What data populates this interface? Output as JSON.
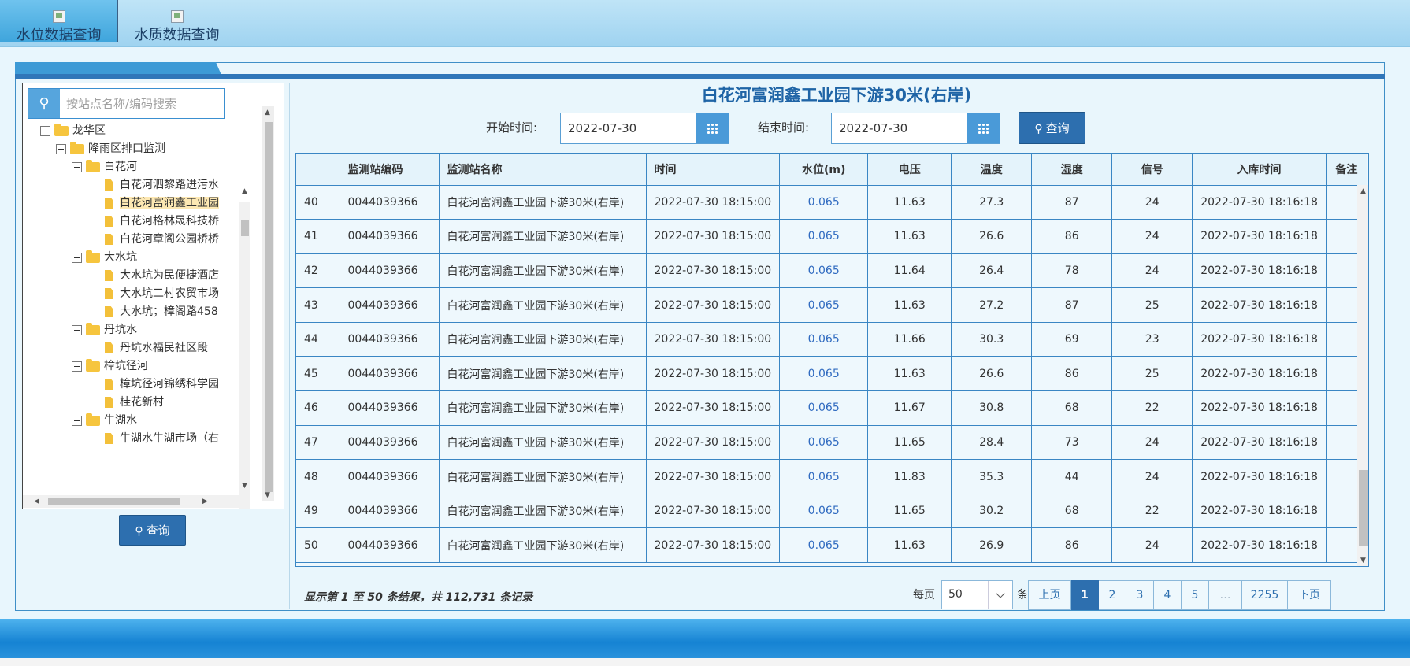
{
  "top_tabs": [
    {
      "label": "水位数据查询",
      "active": true,
      "icon": "image-icon"
    },
    {
      "label": "水质数据查询",
      "active": false,
      "icon": "image-icon"
    }
  ],
  "tree": {
    "search_placeholder": "按站点名称/编码搜索",
    "nodes": [
      {
        "label": "龙华区",
        "type": "folder"
      },
      {
        "label": "降雨区排口监测",
        "type": "folder"
      },
      {
        "label": "白花河",
        "type": "folder"
      },
      {
        "label": "白花河泗黎路进污水",
        "type": "file"
      },
      {
        "label": "白花河富润鑫工业园",
        "type": "file",
        "selected": true
      },
      {
        "label": "白花河格林晟科技桥",
        "type": "file"
      },
      {
        "label": "白花河章阁公园桥桥",
        "type": "file"
      },
      {
        "label": "大水坑",
        "type": "folder"
      },
      {
        "label": "大水坑为民便捷酒店",
        "type": "file"
      },
      {
        "label": "大水坑二村农贸市场",
        "type": "file"
      },
      {
        "label": "大水坑；樟阁路458",
        "type": "file"
      },
      {
        "label": "丹坑水",
        "type": "folder"
      },
      {
        "label": "丹坑水福民社区段",
        "type": "file"
      },
      {
        "label": "樟坑径河",
        "type": "folder"
      },
      {
        "label": "樟坑径河锦绣科学园",
        "type": "file"
      },
      {
        "label": "桂花新村",
        "type": "file"
      },
      {
        "label": "牛湖水",
        "type": "folder"
      },
      {
        "label": "牛湖水牛湖市场（右",
        "type": "file"
      }
    ],
    "query_button": "查询"
  },
  "main": {
    "station_title": "白花河富润鑫工业园下游30米(右岸)",
    "start_label": "开始时间:",
    "start_value": "2022-07-30",
    "end_label": "结束时间:",
    "end_value": "2022-07-30",
    "query_button": "查询"
  },
  "table": {
    "columns": [
      "",
      "监测站编码",
      "监测站名称",
      "时间",
      "水位(m)",
      "电压",
      "温度",
      "湿度",
      "信号",
      "入库时间",
      "备注"
    ],
    "rows": [
      [
        "40",
        "0044039366",
        "白花河富润鑫工业园下游30米(右岸)",
        "2022-07-30 18:15:00",
        "0.065",
        "11.63",
        "27.3",
        "87",
        "24",
        "2022-07-30 18:16:18",
        ""
      ],
      [
        "41",
        "0044039366",
        "白花河富润鑫工业园下游30米(右岸)",
        "2022-07-30 18:15:00",
        "0.065",
        "11.63",
        "26.6",
        "86",
        "24",
        "2022-07-30 18:16:18",
        ""
      ],
      [
        "42",
        "0044039366",
        "白花河富润鑫工业园下游30米(右岸)",
        "2022-07-30 18:15:00",
        "0.065",
        "11.64",
        "26.4",
        "78",
        "24",
        "2022-07-30 18:16:18",
        ""
      ],
      [
        "43",
        "0044039366",
        "白花河富润鑫工业园下游30米(右岸)",
        "2022-07-30 18:15:00",
        "0.065",
        "11.63",
        "27.2",
        "87",
        "25",
        "2022-07-30 18:16:18",
        ""
      ],
      [
        "44",
        "0044039366",
        "白花河富润鑫工业园下游30米(右岸)",
        "2022-07-30 18:15:00",
        "0.065",
        "11.66",
        "30.3",
        "69",
        "23",
        "2022-07-30 18:16:18",
        ""
      ],
      [
        "45",
        "0044039366",
        "白花河富润鑫工业园下游30米(右岸)",
        "2022-07-30 18:15:00",
        "0.065",
        "11.63",
        "26.6",
        "86",
        "25",
        "2022-07-30 18:16:18",
        ""
      ],
      [
        "46",
        "0044039366",
        "白花河富润鑫工业园下游30米(右岸)",
        "2022-07-30 18:15:00",
        "0.065",
        "11.67",
        "30.8",
        "68",
        "22",
        "2022-07-30 18:16:18",
        ""
      ],
      [
        "47",
        "0044039366",
        "白花河富润鑫工业园下游30米(右岸)",
        "2022-07-30 18:15:00",
        "0.065",
        "11.65",
        "28.4",
        "73",
        "24",
        "2022-07-30 18:16:18",
        ""
      ],
      [
        "48",
        "0044039366",
        "白花河富润鑫工业园下游30米(右岸)",
        "2022-07-30 18:15:00",
        "0.065",
        "11.83",
        "35.3",
        "44",
        "24",
        "2022-07-30 18:16:18",
        ""
      ],
      [
        "49",
        "0044039366",
        "白花河富润鑫工业园下游30米(右岸)",
        "2022-07-30 18:15:00",
        "0.065",
        "11.65",
        "30.2",
        "68",
        "22",
        "2022-07-30 18:16:18",
        ""
      ],
      [
        "50",
        "0044039366",
        "白花河富润鑫工业园下游30米(右岸)",
        "2022-07-30 18:15:00",
        "0.065",
        "11.63",
        "26.9",
        "86",
        "24",
        "2022-07-30 18:16:18",
        ""
      ]
    ]
  },
  "footer": {
    "summary": "显示第 1 至 50 条结果，共 112,731 条记录",
    "per_page_label": "每页",
    "per_page_value": "50",
    "per_page_suffix": "条",
    "pages": [
      "上页",
      "1",
      "2",
      "3",
      "4",
      "5",
      "…",
      "2255",
      "下页"
    ],
    "active_page": "1"
  },
  "colors": {
    "accent": "#2d6faf",
    "header_band": "#3076b9",
    "water_level": "#2f6ac0",
    "selected_node": "#fde8b3"
  }
}
